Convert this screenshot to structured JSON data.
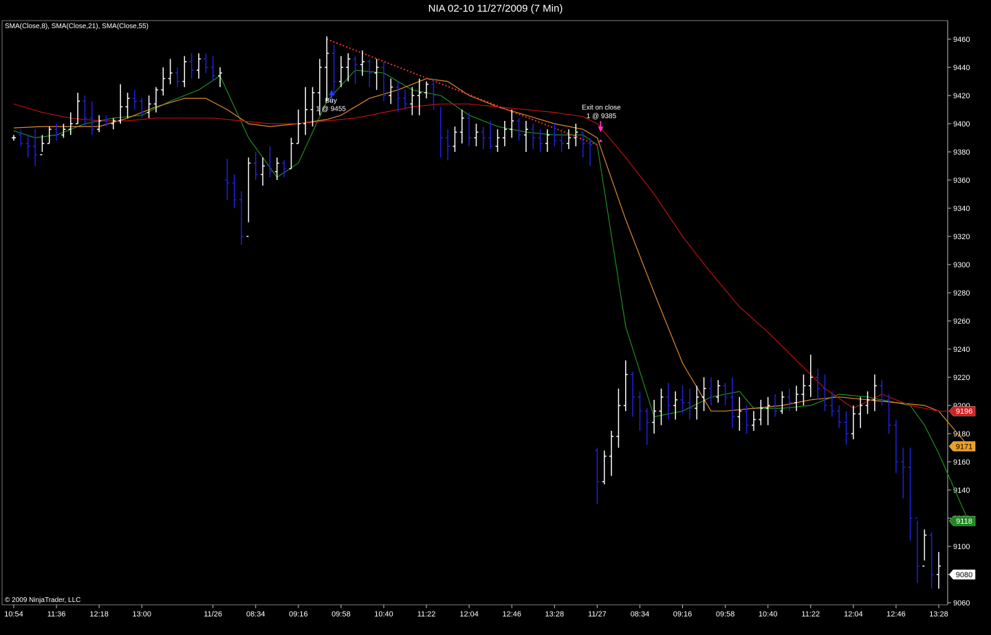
{
  "window": {
    "title": "NIA 02-10  11/27/2009 (7 Min)",
    "indicator_label": "SMA(Close,8), SMA(Close,21), SMA(Close,55)",
    "copyright": "© 2009 NinjaTrader, LLC"
  },
  "chart_data": {
    "type": "ohlc",
    "title": "NIA 02-10  11/27/2009 (7 Min)",
    "ylim": [
      9060,
      9470
    ],
    "y_ticks": [
      9460,
      9440,
      9420,
      9400,
      9380,
      9360,
      9340,
      9320,
      9300,
      9280,
      9260,
      9240,
      9220,
      9200,
      9180,
      9160,
      9140,
      9120,
      9100,
      9080,
      9060
    ],
    "x_ticks": [
      {
        "label": "10:54",
        "x": 0
      },
      {
        "label": "11:36",
        "x": 6
      },
      {
        "label": "12:18",
        "x": 12
      },
      {
        "label": "13:00",
        "x": 18
      },
      {
        "label": "11/26",
        "x": 28
      },
      {
        "label": "08:34",
        "x": 34
      },
      {
        "label": "09:16",
        "x": 40
      },
      {
        "label": "09:58",
        "x": 46
      },
      {
        "label": "10:40",
        "x": 52
      },
      {
        "label": "11:22",
        "x": 58
      },
      {
        "label": "12:04",
        "x": 64
      },
      {
        "label": "12:46",
        "x": 70
      },
      {
        "label": "13:28",
        "x": 76
      },
      {
        "label": "11/27",
        "x": 82
      },
      {
        "label": "08:34",
        "x": 88
      },
      {
        "label": "09:16",
        "x": 94
      },
      {
        "label": "09:58",
        "x": 100
      },
      {
        "label": "10:40",
        "x": 106
      },
      {
        "label": "11:22",
        "x": 112
      },
      {
        "label": "12:04",
        "x": 118
      },
      {
        "label": "12:46",
        "x": 124
      },
      {
        "label": "13:28",
        "x": 130
      }
    ],
    "bars": [
      [
        9390,
        9392,
        9388,
        9390
      ],
      [
        9392,
        9396,
        9384,
        9386
      ],
      [
        9386,
        9392,
        9376,
        9384
      ],
      [
        9384,
        9396,
        9370,
        9378
      ],
      [
        9378,
        9392,
        9380,
        9386
      ],
      [
        9386,
        9398,
        9386,
        9396
      ],
      [
        9396,
        9400,
        9388,
        9392
      ],
      [
        9392,
        9400,
        9390,
        9396
      ],
      [
        9396,
        9408,
        9392,
        9400
      ],
      [
        9400,
        9422,
        9400,
        9416
      ],
      [
        9416,
        9420,
        9398,
        9404
      ],
      [
        9404,
        9416,
        9392,
        9396
      ],
      [
        9396,
        9406,
        9394,
        9402
      ],
      [
        9402,
        9406,
        9398,
        9400
      ],
      [
        9400,
        9404,
        9396,
        9402
      ],
      [
        9402,
        9428,
        9400,
        9412
      ],
      [
        9412,
        9422,
        9404,
        9418
      ],
      [
        9418,
        9424,
        9410,
        9416
      ],
      [
        9416,
        9418,
        9404,
        9408
      ],
      [
        9408,
        9420,
        9404,
        9414
      ],
      [
        9414,
        9426,
        9408,
        9424
      ],
      [
        9424,
        9440,
        9420,
        9432
      ],
      [
        9432,
        9446,
        9428,
        9436
      ],
      [
        9436,
        9440,
        9426,
        9430
      ],
      [
        9430,
        9448,
        9426,
        9444
      ],
      [
        9444,
        9450,
        9432,
        9438
      ],
      [
        9438,
        9450,
        9432,
        9446
      ],
      [
        9446,
        9450,
        9436,
        9440
      ],
      [
        9440,
        9448,
        9430,
        9434
      ],
      [
        9434,
        9440,
        9426,
        9436
      ],
      [
        9360,
        9375,
        9346,
        9358
      ],
      [
        9358,
        9364,
        9340,
        9346
      ],
      [
        9346,
        9352,
        9314,
        9320
      ],
      [
        9320,
        9376,
        9330,
        9372
      ],
      [
        9372,
        9380,
        9360,
        9364
      ],
      [
        9364,
        9376,
        9356,
        9370
      ],
      [
        9370,
        9384,
        9362,
        9366
      ],
      [
        9366,
        9376,
        9360,
        9372
      ],
      [
        9372,
        9374,
        9362,
        9368
      ],
      [
        9368,
        9390,
        9368,
        9386
      ],
      [
        9386,
        9410,
        9386,
        9400
      ],
      [
        9400,
        9426,
        9392,
        9410
      ],
      [
        9410,
        9426,
        9398,
        9422
      ],
      [
        9422,
        9446,
        9406,
        9440
      ],
      [
        9440,
        9462,
        9416,
        9450
      ],
      [
        9450,
        9456,
        9420,
        9430
      ],
      [
        9430,
        9448,
        9426,
        9440
      ],
      [
        9440,
        9450,
        9430,
        9446
      ],
      [
        9446,
        9448,
        9428,
        9442
      ],
      [
        9442,
        9452,
        9434,
        9444
      ],
      [
        9444,
        9446,
        9426,
        9436
      ],
      [
        9436,
        9446,
        9424,
        9440
      ],
      [
        9440,
        9444,
        9416,
        9420
      ],
      [
        9420,
        9432,
        9414,
        9426
      ],
      [
        9426,
        9430,
        9408,
        9418
      ],
      [
        9418,
        9424,
        9410,
        9414
      ],
      [
        9414,
        9426,
        9406,
        9420
      ],
      [
        9420,
        9432,
        9406,
        9422
      ],
      [
        9422,
        9430,
        9418,
        9428
      ],
      [
        9428,
        9432,
        9410,
        9420
      ],
      [
        9420,
        9412,
        9376,
        9390
      ],
      [
        9390,
        9396,
        9374,
        9384
      ],
      [
        9384,
        9398,
        9380,
        9394
      ],
      [
        9394,
        9410,
        9386,
        9404
      ],
      [
        9404,
        9408,
        9384,
        9390
      ],
      [
        9390,
        9400,
        9384,
        9394
      ],
      [
        9394,
        9398,
        9382,
        9390
      ],
      [
        9390,
        9402,
        9382,
        9384
      ],
      [
        9384,
        9396,
        9380,
        9390
      ],
      [
        9390,
        9402,
        9384,
        9396
      ],
      [
        9396,
        9410,
        9390,
        9402
      ],
      [
        9402,
        9404,
        9388,
        9392
      ],
      [
        9392,
        9402,
        9380,
        9396
      ],
      [
        9396,
        9400,
        9382,
        9390
      ],
      [
        9390,
        9396,
        9380,
        9386
      ],
      [
        9386,
        9396,
        9380,
        9392
      ],
      [
        9392,
        9400,
        9384,
        9388
      ],
      [
        9388,
        9394,
        9380,
        9386
      ],
      [
        9386,
        9396,
        9382,
        9390
      ],
      [
        9390,
        9400,
        9384,
        9394
      ],
      [
        9394,
        9394,
        9376,
        9386
      ],
      [
        9386,
        9390,
        9370,
        9385
      ],
      [
        9168,
        9170,
        9130,
        9146
      ],
      [
        9146,
        9168,
        9144,
        9164
      ],
      [
        9164,
        9182,
        9150,
        9178
      ],
      [
        9178,
        9212,
        9170,
        9200
      ],
      [
        9200,
        9232,
        9196,
        9222
      ],
      [
        9222,
        9224,
        9192,
        9206
      ],
      [
        9206,
        9210,
        9182,
        9196
      ],
      [
        9196,
        9198,
        9172,
        9188
      ],
      [
        9188,
        9204,
        9180,
        9196
      ],
      [
        9196,
        9212,
        9186,
        9206
      ],
      [
        9206,
        9216,
        9190,
        9200
      ],
      [
        9200,
        9210,
        9190,
        9204
      ],
      [
        9204,
        9214,
        9194,
        9202
      ],
      [
        9202,
        9212,
        9190,
        9198
      ],
      [
        9198,
        9214,
        9190,
        9206
      ],
      [
        9206,
        9220,
        9196,
        9212
      ],
      [
        9212,
        9220,
        9200,
        9206
      ],
      [
        9206,
        9218,
        9202,
        9214
      ],
      [
        9214,
        9216,
        9200,
        9206
      ],
      [
        9206,
        9220,
        9184,
        9192
      ],
      [
        9192,
        9206,
        9182,
        9196
      ],
      [
        9196,
        9200,
        9180,
        9186
      ],
      [
        9186,
        9196,
        9182,
        9190
      ],
      [
        9190,
        9204,
        9186,
        9198
      ],
      [
        9198,
        9206,
        9186,
        9200
      ],
      [
        9200,
        9208,
        9192,
        9196
      ],
      [
        9196,
        9210,
        9194,
        9206
      ],
      [
        9206,
        9212,
        9196,
        9202
      ],
      [
        9202,
        9214,
        9196,
        9208
      ],
      [
        9208,
        9222,
        9200,
        9214
      ],
      [
        9214,
        9236,
        9206,
        9220
      ],
      [
        9220,
        9226,
        9204,
        9212
      ],
      [
        9212,
        9222,
        9196,
        9200
      ],
      [
        9200,
        9210,
        9192,
        9196
      ],
      [
        9196,
        9200,
        9184,
        9188
      ],
      [
        9188,
        9196,
        9172,
        9180
      ],
      [
        9180,
        9200,
        9176,
        9194
      ],
      [
        9194,
        9206,
        9184,
        9200
      ],
      [
        9200,
        9210,
        9194,
        9204
      ],
      [
        9204,
        9222,
        9196,
        9214
      ],
      [
        9214,
        9218,
        9200,
        9204
      ],
      [
        9204,
        9208,
        9180,
        9186
      ],
      [
        9186,
        9190,
        9152,
        9160
      ],
      [
        9160,
        9170,
        9134,
        9156
      ],
      [
        9156,
        9170,
        9104,
        9120
      ],
      [
        9120,
        9118,
        9074,
        9086
      ],
      [
        9086,
        9112,
        9090,
        9108
      ],
      [
        9108,
        9110,
        9070,
        9080
      ],
      [
        9080,
        9096,
        9070,
        9086
      ]
    ],
    "sma": [
      {
        "name": "SMA(Close,8)",
        "color": "#1f8f1f",
        "points": [
          [
            0,
            9395
          ],
          [
            3,
            9390
          ],
          [
            6,
            9392
          ],
          [
            10,
            9400
          ],
          [
            14,
            9404
          ],
          [
            18,
            9406
          ],
          [
            22,
            9416
          ],
          [
            26,
            9424
          ],
          [
            29,
            9434
          ],
          [
            33,
            9390
          ],
          [
            37,
            9362
          ],
          [
            40,
            9372
          ],
          [
            44,
            9416
          ],
          [
            48,
            9438
          ],
          [
            52,
            9436
          ],
          [
            56,
            9424
          ],
          [
            60,
            9420
          ],
          [
            64,
            9406
          ],
          [
            68,
            9398
          ],
          [
            72,
            9394
          ],
          [
            76,
            9392
          ],
          [
            80,
            9392
          ],
          [
            82,
            9385
          ],
          [
            86,
            9256
          ],
          [
            90,
            9192
          ],
          [
            94,
            9196
          ],
          [
            98,
            9206
          ],
          [
            102,
            9210
          ],
          [
            104,
            9198
          ],
          [
            108,
            9198
          ],
          [
            112,
            9200
          ],
          [
            116,
            9208
          ],
          [
            120,
            9206
          ],
          [
            124,
            9202
          ],
          [
            126,
            9200
          ],
          [
            128,
            9186
          ],
          [
            130,
            9166
          ],
          [
            134,
            9120
          ]
        ]
      },
      {
        "name": "SMA(Close,21)",
        "color": "#e08b2e",
        "points": [
          [
            0,
            9397
          ],
          [
            4,
            9398
          ],
          [
            8,
            9398
          ],
          [
            12,
            9398
          ],
          [
            16,
            9404
          ],
          [
            20,
            9412
          ],
          [
            24,
            9418
          ],
          [
            27,
            9418
          ],
          [
            30,
            9410
          ],
          [
            33,
            9400
          ],
          [
            36,
            9398
          ],
          [
            40,
            9400
          ],
          [
            44,
            9403
          ],
          [
            46,
            9406
          ],
          [
            50,
            9418
          ],
          [
            54,
            9424
          ],
          [
            58,
            9432
          ],
          [
            61,
            9430
          ],
          [
            64,
            9420
          ],
          [
            68,
            9412
          ],
          [
            72,
            9406
          ],
          [
            76,
            9400
          ],
          [
            80,
            9396
          ],
          [
            82,
            9390
          ],
          [
            86,
            9332
          ],
          [
            90,
            9280
          ],
          [
            94,
            9230
          ],
          [
            98,
            9196
          ],
          [
            100,
            9196
          ],
          [
            104,
            9198
          ],
          [
            108,
            9200
          ],
          [
            112,
            9204
          ],
          [
            116,
            9206
          ],
          [
            120,
            9204
          ],
          [
            124,
            9202
          ],
          [
            128,
            9200
          ],
          [
            130,
            9196
          ],
          [
            134,
            9172
          ]
        ]
      },
      {
        "name": "SMA(Close,55)",
        "color": "#c01010",
        "points": [
          [
            0,
            9414
          ],
          [
            4,
            9408
          ],
          [
            8,
            9404
          ],
          [
            12,
            9402
          ],
          [
            16,
            9402
          ],
          [
            20,
            9404
          ],
          [
            24,
            9404
          ],
          [
            28,
            9404
          ],
          [
            32,
            9402
          ],
          [
            36,
            9400
          ],
          [
            40,
            9400
          ],
          [
            44,
            9402
          ],
          [
            48,
            9404
          ],
          [
            52,
            9408
          ],
          [
            56,
            9412
          ],
          [
            60,
            9414
          ],
          [
            64,
            9414
          ],
          [
            68,
            9412
          ],
          [
            72,
            9410
          ],
          [
            76,
            9408
          ],
          [
            80,
            9405
          ],
          [
            82,
            9400
          ],
          [
            86,
            9376
          ],
          [
            90,
            9350
          ],
          [
            94,
            9320
          ],
          [
            98,
            9294
          ],
          [
            102,
            9270
          ],
          [
            106,
            9252
          ],
          [
            110,
            9232
          ],
          [
            114,
            9212
          ],
          [
            118,
            9198
          ],
          [
            122,
            9208
          ],
          [
            126,
            9200
          ],
          [
            130,
            9196
          ],
          [
            134,
            9196
          ]
        ]
      }
    ],
    "trade_line": {
      "from": [
        44,
        9460
      ],
      "to": [
        82,
        9385
      ],
      "color": "#ff3030"
    },
    "annotations": [
      {
        "text": "Buy",
        "x": 44,
        "y": 9415,
        "color": "#ffffff"
      },
      {
        "text": "1 @ 9455",
        "x": 44,
        "y": 9409,
        "color": "#ffffff"
      },
      {
        "text": "Exit on close",
        "x": 82,
        "y": 9410,
        "color": "#ffffff"
      },
      {
        "text": "1 @ 9385",
        "x": 82,
        "y": 9404,
        "color": "#ffffff"
      }
    ],
    "price_markers": [
      {
        "text": "9196",
        "y": 9196,
        "bg": "#d02020",
        "fg": "#ffffff"
      },
      {
        "text": "9171",
        "y": 9171,
        "bg": "#f0a020",
        "fg": "#000000"
      },
      {
        "text": "9118",
        "y": 9118,
        "bg": "#1a8a1a",
        "fg": "#ffffff"
      },
      {
        "text": "9080",
        "y": 9080,
        "bg": "#ffffff",
        "fg": "#000000"
      }
    ],
    "colors": {
      "up_bar": "#ffffff",
      "down_bar": "#2020e0",
      "background": "#000000",
      "buy_marker": "#2040ff",
      "exit_marker": "#ff30c0"
    }
  }
}
